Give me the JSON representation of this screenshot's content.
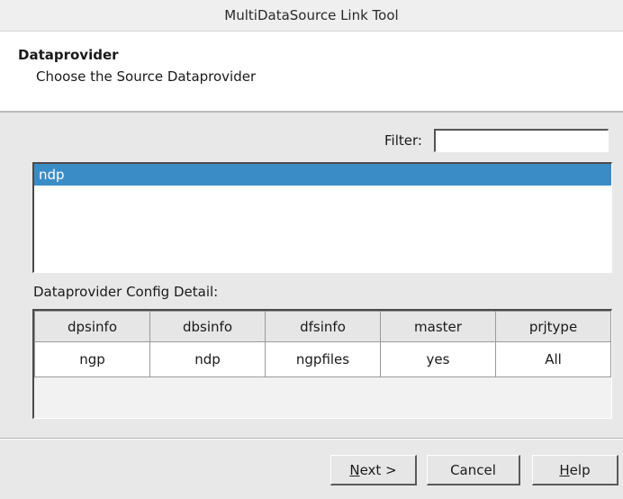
{
  "window": {
    "title": "MultiDataSource Link Tool"
  },
  "header": {
    "title": "Dataprovider",
    "subtitle": "Choose the Source Dataprovider"
  },
  "filter": {
    "label": "Filter:",
    "value": ""
  },
  "provider_list": {
    "items": [
      {
        "label": "ndp",
        "selected": true
      }
    ]
  },
  "config_detail": {
    "label": "Dataprovider Config Detail:",
    "columns": [
      "dpsinfo",
      "dbsinfo",
      "dfsinfo",
      "master",
      "prjtype"
    ],
    "rows": [
      [
        "ngp",
        "ndp",
        "ngpfiles",
        "yes",
        "All"
      ]
    ]
  },
  "buttons": {
    "next": {
      "mnemonic": "N",
      "rest": "ext >"
    },
    "cancel": "Cancel",
    "help": {
      "mnemonic": "H",
      "rest": "elp"
    }
  },
  "colors": {
    "selection": "#3a8cc6",
    "window_bg": "#e8e8e8",
    "header_bg": "#ffffff"
  }
}
